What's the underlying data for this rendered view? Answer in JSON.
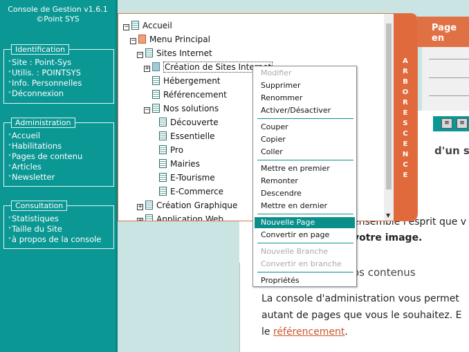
{
  "app": {
    "title": "Console de Gestion v1.6.1",
    "subtitle": "©Point SYS"
  },
  "identification": {
    "title": "Identification",
    "items": [
      "Site : Point-Sys",
      "Utilis. : POINTSYS",
      "Info. Personnelles",
      "Déconnexion"
    ]
  },
  "administration": {
    "title": "Administration",
    "items": [
      "Accueil",
      "Habilitations",
      "Pages de contenu",
      "Articles",
      "Newsletter"
    ]
  },
  "consultation": {
    "title": "Consultation",
    "items": [
      "Statistiques",
      "Taille du Site",
      "à propos de la console"
    ]
  },
  "tree": {
    "nodes": [
      "Accueil",
      "Menu Principal",
      "Sites Internet",
      "Création de Sites Internet",
      "Hébergement",
      "Référencement",
      "Nos solutions",
      "Découverte",
      "Essentielle",
      "Pro",
      "Mairies",
      "E-Tourisme",
      "E-Commerce",
      "Création Graphique",
      "Application Web"
    ],
    "side_label": "ARBORESCENCE"
  },
  "context_menu": {
    "modifier": "Modifier",
    "supprimer": "Supprimer",
    "renommer": "Renommer",
    "activer": "Activer/Désactiver",
    "couper": "Couper",
    "copier": "Copier",
    "coller": "Coller",
    "premier": "Mettre en premier",
    "remonter": "Remonter",
    "descendre": "Descendre",
    "dernier": "Mettre en dernier",
    "nouvelle_page": "Nouvelle Page",
    "convertir_page": "Convertir en page",
    "nouvelle_branche": "Nouvelle Branche",
    "convertir_branche": "Convertir en branche",
    "proprietes": "Propriétés"
  },
  "background_page": {
    "header": "Page en",
    "heading_fragment": "d'un si",
    "line1": "ensemble l'esprit que v",
    "line2": "votre image.",
    "section": "os contenus",
    "para1": "La console d'administration vous permet",
    "para2": "autant de pages que vous le souhaitez. E",
    "para3_pre": "le ",
    "para3_link": "référencement",
    "para3_post": "."
  },
  "colors": {
    "sidebar": "#0b9894",
    "accent": "#e06a3c",
    "highlight": "#0b8f8b",
    "link": "#c8552d"
  }
}
